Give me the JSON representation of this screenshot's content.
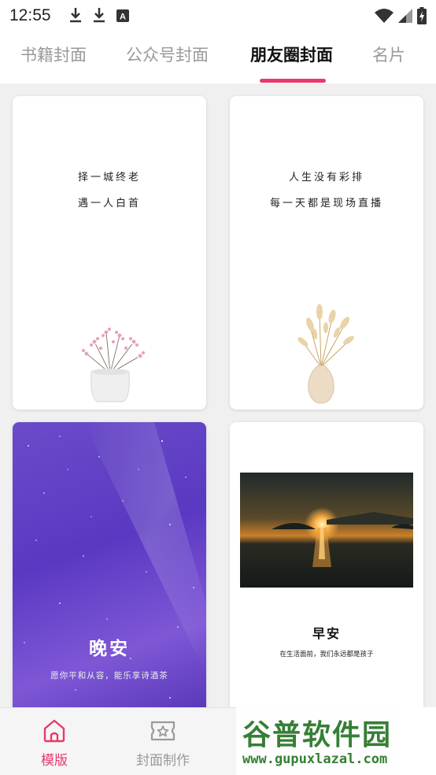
{
  "status_bar": {
    "time": "12:55",
    "left_icons": [
      "download-icon",
      "download-icon",
      "font-icon"
    ],
    "right_icons": [
      "wifi-icon",
      "signal-icon",
      "battery-icon"
    ]
  },
  "tabs": [
    {
      "label": "书籍封面",
      "active": false
    },
    {
      "label": "公众号封面",
      "active": false
    },
    {
      "label": "朋友圈封面",
      "active": true
    },
    {
      "label": "名片",
      "active": false
    }
  ],
  "accent_color": "#e63b6c",
  "cards": {
    "card1": {
      "lines": [
        "择一城终老",
        "遇一人白首"
      ],
      "image": "flower-vase"
    },
    "card2": {
      "lines": [
        "人生没有彩排",
        "每一天都是现场直播"
      ],
      "image": "dried-grass-vase"
    },
    "card3": {
      "title": "晚安",
      "subtitle": "愿你平和从容，能乐享诗酒茶",
      "image": "starry-purple-sky"
    },
    "card4": {
      "title": "早安",
      "subtitle": "在生活面前，我们永远都是孩子",
      "image": "sunset-sea"
    }
  },
  "bottom_nav": [
    {
      "label": "模版",
      "icon": "home-icon",
      "active": true
    },
    {
      "label": "封面制作",
      "icon": "ticket-star-icon",
      "active": false
    }
  ],
  "watermark": {
    "title": "谷普软件园",
    "url": "www.gupuxlazal.com"
  }
}
